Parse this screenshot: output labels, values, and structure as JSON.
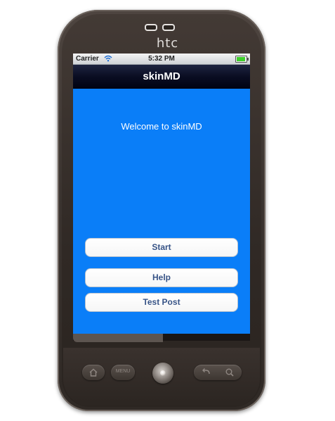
{
  "device": {
    "brand": "htc"
  },
  "statusbar": {
    "carrier": "Carrier",
    "time": "5:32 PM",
    "battery_level": 0.9
  },
  "navbar": {
    "title": "skinMD"
  },
  "main": {
    "welcome_text": "Welcome to skinMD",
    "buttons": [
      {
        "label": "Start"
      },
      {
        "label": "Help"
      },
      {
        "label": "Test Post"
      }
    ]
  },
  "hardware_buttons": {
    "home_icon": "home-icon",
    "menu_label": "MENU",
    "back_icon": "back-arrow-icon",
    "search_icon": "search-icon"
  },
  "colors": {
    "screen_background": "#0a7ef8",
    "navbar": "#000212",
    "button_text": "#385487"
  }
}
